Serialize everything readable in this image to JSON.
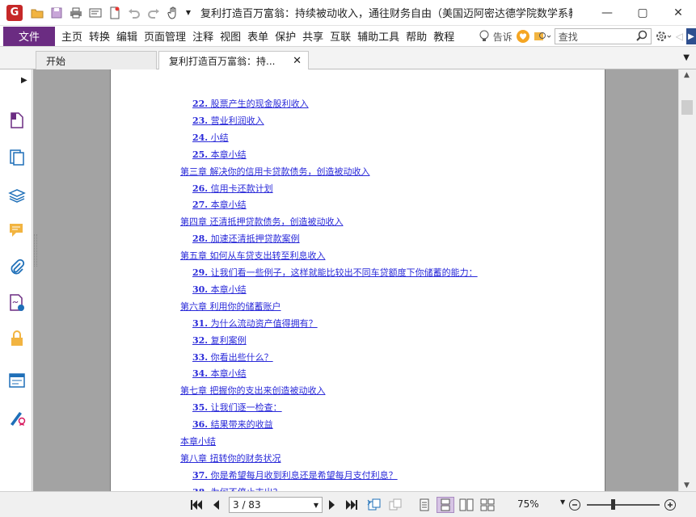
{
  "app": {
    "logo_letter": "G",
    "title": "复利打造百万富翁：持续被动收入，通往财务自由（美国迈阿密达德学院数学系教授...",
    "window_controls": {
      "minimize": "—",
      "restore": "▢",
      "close": "✕"
    }
  },
  "menu": {
    "file": "文件",
    "items": [
      "主页",
      "转换",
      "编辑",
      "页面管理",
      "注释",
      "视图",
      "表单",
      "保护",
      "共享",
      "互联",
      "辅助工具",
      "帮助",
      "教程"
    ],
    "tell_me": "告诉",
    "search_placeholder": "查找"
  },
  "tabs": [
    {
      "label": "开始"
    },
    {
      "label": "复利打造百万富翁：持...",
      "close": "✕"
    }
  ],
  "toc": [
    {
      "num": "22.",
      "text": "股票产生的现金股利收入",
      "indent": 1
    },
    {
      "num": "23.",
      "text": "营业利润收入",
      "indent": 1
    },
    {
      "num": "24.",
      "text": "小结",
      "indent": 1
    },
    {
      "num": "25.",
      "text": "本章小结",
      "indent": 1
    },
    {
      "num": "",
      "text": "第三章 解决你的信用卡贷款债务，创造被动收入",
      "indent": 0
    },
    {
      "num": "26.",
      "text": "信用卡还款计划",
      "indent": 1
    },
    {
      "num": "27.",
      "text": "本章小结",
      "indent": 1
    },
    {
      "num": "",
      "text": "第四章 还清抵押贷款债务，创造被动收入",
      "indent": 0
    },
    {
      "num": "28.",
      "text": "加速还清抵押贷款案例",
      "indent": 1
    },
    {
      "num": "",
      "text": "第五章 如何从车贷支出转至利息收入",
      "indent": 0
    },
    {
      "num": "29.",
      "text": "让我们看一些例子，这样就能比较出不同车贷额度下你储蓄的能力：",
      "indent": 1
    },
    {
      "num": "30.",
      "text": "本章小结",
      "indent": 1
    },
    {
      "num": "",
      "text": "第六章 利用你的储蓄账户",
      "indent": 0
    },
    {
      "num": "31.",
      "text": "为什么流动资产值得拥有？",
      "indent": 1
    },
    {
      "num": "32.",
      "text": "复利案例",
      "indent": 1
    },
    {
      "num": "33.",
      "text": "你看出些什么？",
      "indent": 1
    },
    {
      "num": "34.",
      "text": "本章小结",
      "indent": 1
    },
    {
      "num": "",
      "text": "第七章 把握你的支出来创造被动收入",
      "indent": 0
    },
    {
      "num": "35.",
      "text": "让我们逐一检查：",
      "indent": 1
    },
    {
      "num": "36.",
      "text": "结果带来的收益",
      "indent": 1
    },
    {
      "num": "",
      "text": "本章小结",
      "indent": 0
    },
    {
      "num": "",
      "text": "第八章 扭转你的财务状况",
      "indent": 0
    },
    {
      "num": "37.",
      "text": "你是希望每月收到利息还是希望每月支付利息？",
      "indent": 1
    },
    {
      "num": "38.",
      "text": "为何不停止支出？",
      "indent": 1
    }
  ],
  "status": {
    "page_display": "3 / 83",
    "zoom": "75%"
  },
  "colors": {
    "accent": "#6b2c82",
    "link": "#2a2ad9",
    "doc_background": "#a3a3a3"
  }
}
